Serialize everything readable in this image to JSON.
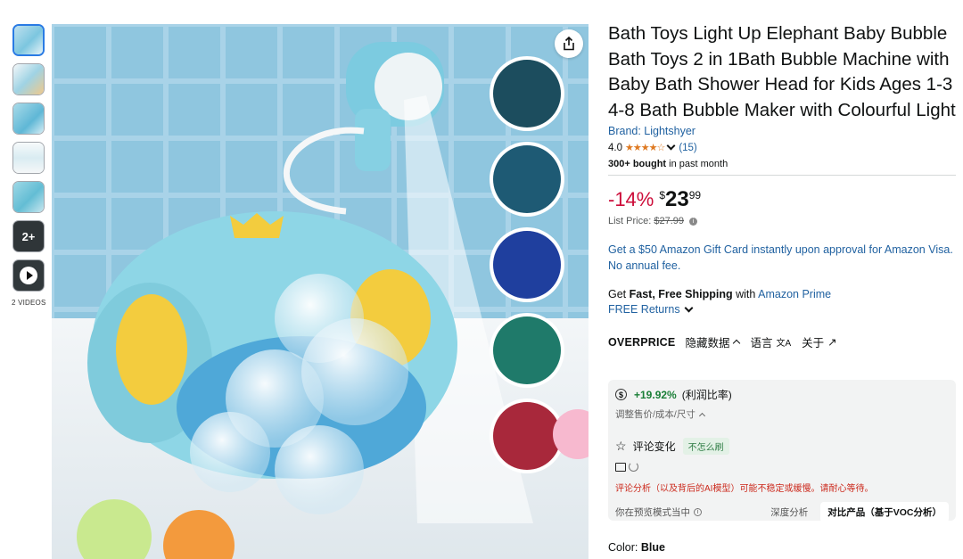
{
  "thumbnails": {
    "more_label": "2+",
    "videos_label": "2 VIDEOS"
  },
  "product": {
    "title": "Bath Toys Light Up Elephant Baby Bubble Bath Toys 2 in 1Bath Bubble Machine with Baby Bath Shower Head for Kids Ages 1-3 4-8 Bath Bubble Maker with Colourful Light",
    "brand": "Brand: Lightshyer",
    "rating": "4.0",
    "stars": "★★★★☆",
    "review_count": "(15)",
    "bought_bold": "300+ bought",
    "bought_rest": " in past month"
  },
  "price": {
    "discount": "-14%",
    "currency": "$",
    "whole": "23",
    "fraction": "99",
    "list_label": "List Price: ",
    "list_value": "$27.99",
    "info_icon": "i"
  },
  "offers": {
    "giftcard": "Get a $50 Amazon Gift Card instantly upon approval for Amazon Visa. No annual fee.",
    "ship_prefix": "Get ",
    "ship_bold": "Fast, Free Shipping",
    "ship_mid": " with ",
    "ship_link": "Amazon Prime",
    "returns": "FREE Returns"
  },
  "overprice": {
    "brand": "OVERPRICE",
    "hide_data": "隐藏数据",
    "language": "语言",
    "lang_icon": "文A",
    "about": "关于",
    "about_icon": "↗"
  },
  "extension": {
    "dollar_icon": "$",
    "profit": "+19.92%",
    "profit_label": "(利润比率)",
    "adjust": "调整售价/成本/尺寸",
    "review_change": "评论变化",
    "badge": "不怎么刷",
    "warning": "评论分析（以及背后的AI模型）可能不稳定或缓慢。请耐心等待。",
    "preview_mode": "你在预览模式当中",
    "preview_info_icon": "i",
    "deep_analysis": "深度分析",
    "compare": "对比产品（基于VOC分析）"
  },
  "color": {
    "label": "Color: ",
    "value": "Blue"
  },
  "colors": {
    "accent_link": "#2162a1",
    "discount_red": "#cc0c39",
    "star_orange": "#de7921",
    "profit_green": "#1a7f37"
  }
}
